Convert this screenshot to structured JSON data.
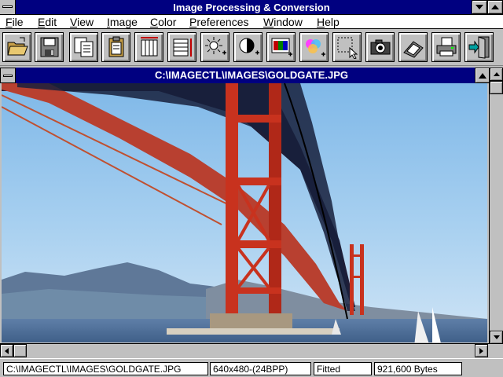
{
  "app": {
    "title": "Image Processing & Conversion"
  },
  "menu": [
    {
      "pre": "",
      "key": "F",
      "post": "ile"
    },
    {
      "pre": "",
      "key": "E",
      "post": "dit"
    },
    {
      "pre": "",
      "key": "V",
      "post": "iew"
    },
    {
      "pre": "",
      "key": "I",
      "post": "mage"
    },
    {
      "pre": "",
      "key": "C",
      "post": "olor"
    },
    {
      "pre": "",
      "key": "P",
      "post": "references"
    },
    {
      "pre": "",
      "key": "W",
      "post": "indow"
    },
    {
      "pre": "",
      "key": "H",
      "post": "elp"
    }
  ],
  "toolbar": {
    "icons": [
      "open-folder-icon",
      "save-disk-icon",
      "copy-pages-icon",
      "paste-clipboard-icon",
      "resize-width-icon",
      "resize-height-icon",
      "brightness-icon",
      "contrast-icon",
      "color-balance-icon",
      "color-palette-icon",
      "select-region-icon",
      "camera-icon",
      "scanner-icon",
      "print-icon",
      "exit-icon"
    ]
  },
  "document": {
    "title": "C:\\IMAGECTL\\IMAGES\\GOLDGATE.JPG"
  },
  "status": {
    "path": "C:\\IMAGECTL\\IMAGES\\GOLDGATE.JPG",
    "dimensions": "640x480-(24BPP)",
    "mode": "Fitted",
    "size": "921,600 Bytes"
  }
}
